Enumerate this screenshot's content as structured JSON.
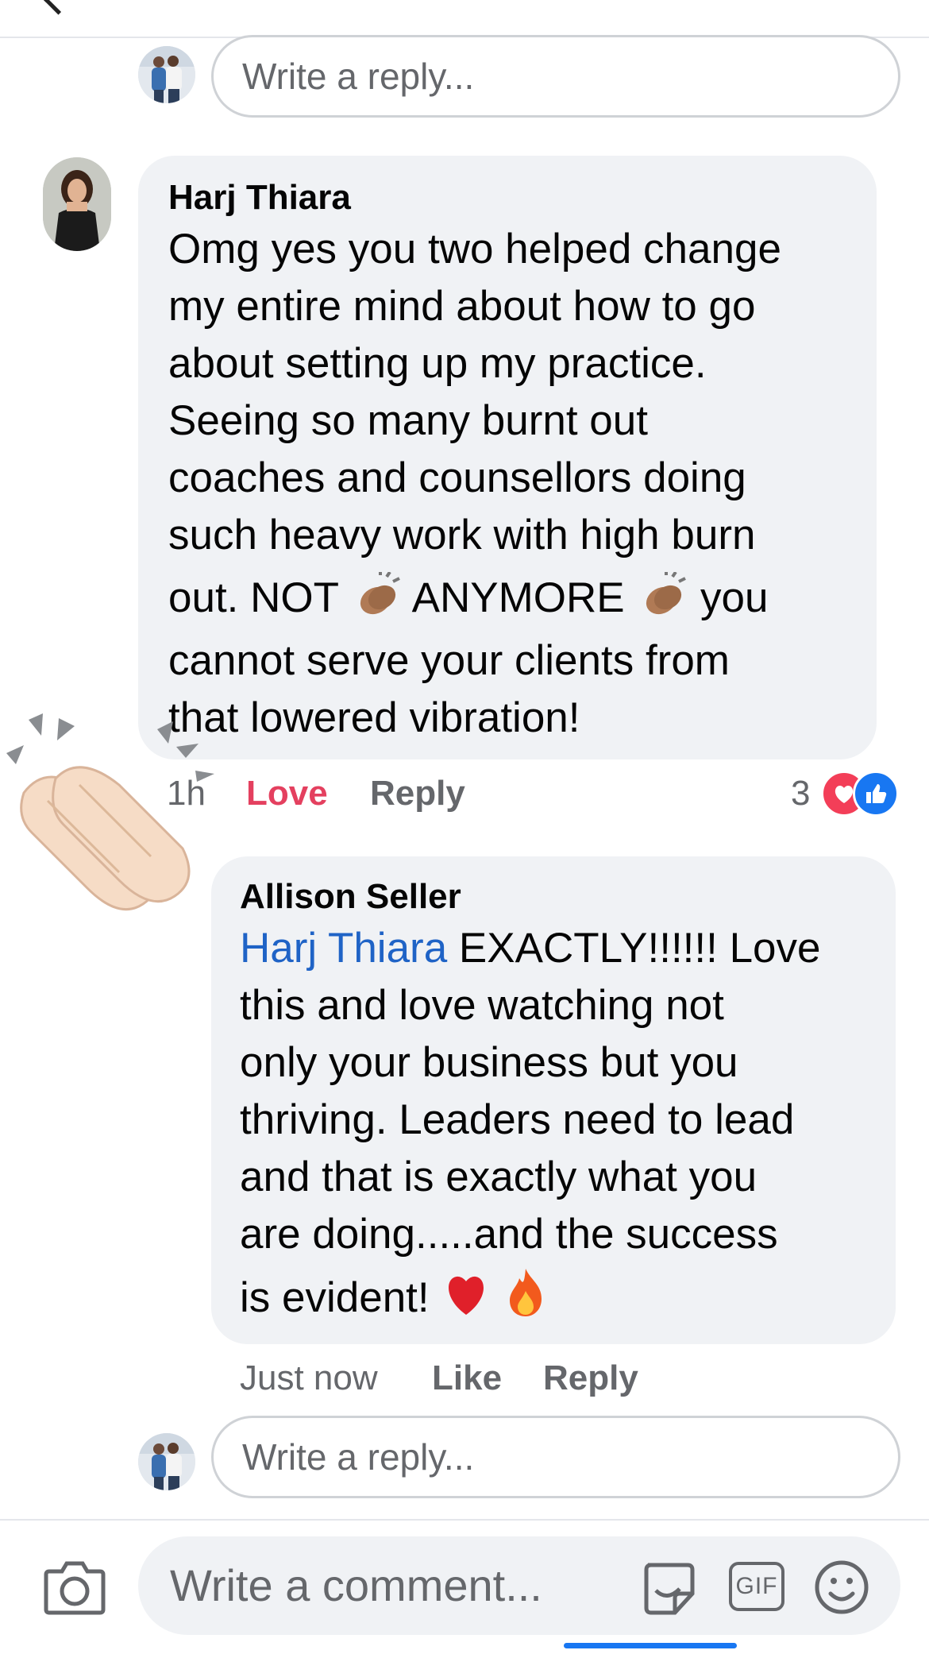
{
  "top_reply": {
    "placeholder": "Write a reply..."
  },
  "comment": {
    "author": "Harj Thiara",
    "lines": [
      "Omg yes you two helped change",
      "my entire mind about how to go",
      "about setting up my practice.",
      "Seeing so many burnt out",
      "coaches and counsellors doing",
      "such heavy work with high burn"
    ],
    "line7_a": "out. NOT",
    "line7_b": "ANYMORE",
    "line7_c": "you",
    "lines_tail": [
      "cannot serve your clients from",
      "that lowered vibration!"
    ],
    "time": "1h",
    "reaction_label": "Love",
    "reply_label": "Reply",
    "reaction_count": "3",
    "reaction_icons": [
      "heart-icon",
      "like-icon"
    ]
  },
  "reply": {
    "author": "Allison Seller",
    "mention": "Harj Thiara",
    "first_line_rest": " EXACTLY!!!!!! Love",
    "lines": [
      "this and love watching not",
      "only your business but you",
      "thriving. Leaders need to lead",
      "and that is exactly what you",
      "are doing.....and the success"
    ],
    "last_line": "is evident!",
    "last_emojis": [
      "red-heart-emoji",
      "fire-emoji"
    ],
    "time": "Just now",
    "like_label": "Like",
    "reply_label": "Reply"
  },
  "bottom_reply": {
    "placeholder": "Write a reply..."
  },
  "composer": {
    "placeholder": "Write a comment...",
    "gif_label": "GIF"
  },
  "colors": {
    "bubble": "#f0f2f5",
    "love": "#e4405f",
    "mention": "#1f63c6",
    "like_blue": "#1877f2",
    "heart_red": "#f33e58"
  }
}
